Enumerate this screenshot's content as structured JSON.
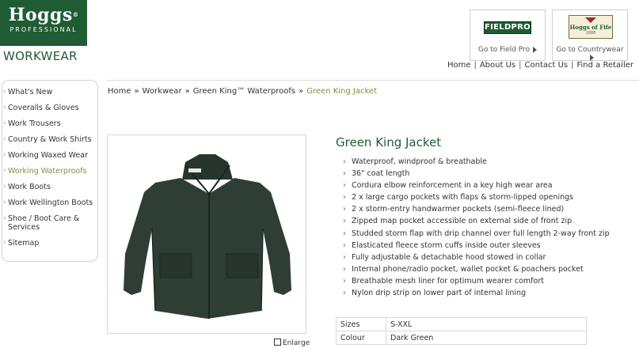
{
  "brand": {
    "name": "Hoggs",
    "reg": "®",
    "sub": "PROFESSIONAL",
    "section": "WORKWEAR",
    "color": "#1f5c33"
  },
  "partners": {
    "fieldpro": {
      "logo_text": "FIELDPRO",
      "goto": "Go to Field Pro"
    },
    "fife": {
      "logo_text": "Hoggs of Fife",
      "logo_year": "1888",
      "goto": "Go to Countrywear"
    }
  },
  "toplinks": [
    "Home",
    "About Us",
    "Contact Us",
    "Find a Retailer"
  ],
  "sidebar": {
    "items": [
      {
        "label": "What's New"
      },
      {
        "label": "Coveralls & Gloves"
      },
      {
        "label": "Work Trousers"
      },
      {
        "label": "Country & Work Shirts"
      },
      {
        "label": "Working Waxed Wear"
      },
      {
        "label": "Working Waterproofs",
        "active": true
      },
      {
        "label": "Work Boots"
      },
      {
        "label": "Work Wellington Boots"
      },
      {
        "label": "Shoe / Boot Care & Services"
      },
      {
        "label": "Sitemap"
      }
    ]
  },
  "breadcrumb": [
    "Home",
    "Workwear",
    "Green King™ Waterproofs",
    "Green King Jacket"
  ],
  "breadcrumb_sep": "»",
  "product": {
    "title": "Green King Jacket",
    "enlarge": "Enlarge",
    "features": [
      "Waterproof, windproof & breathable",
      "36\" coat length",
      "Cordura elbow reinforcement in a key high wear area",
      "2 x large cargo pockets with flaps & storm-lipped openings",
      "2 x storm-entry handwarmer pockets (semi-fleece lined)",
      "Zipped map pocket accessible on external side of front zip",
      "Studded storm flap with drip channel over full length 2-way front zip",
      "Elasticated fleece storm cuffs inside outer sleeves",
      "Fully adjustable & detachable hood stowed in collar",
      "Internal phone/radio pocket, wallet pocket & poachers pocket",
      "Breathable mesh liner for optimum wearer comfort",
      "Nylon drip strip on lower part of internal lining"
    ],
    "specs": [
      {
        "key": "Sizes",
        "value": "S-XXL"
      },
      {
        "key": "Colour",
        "value": "Dark Green"
      }
    ]
  }
}
